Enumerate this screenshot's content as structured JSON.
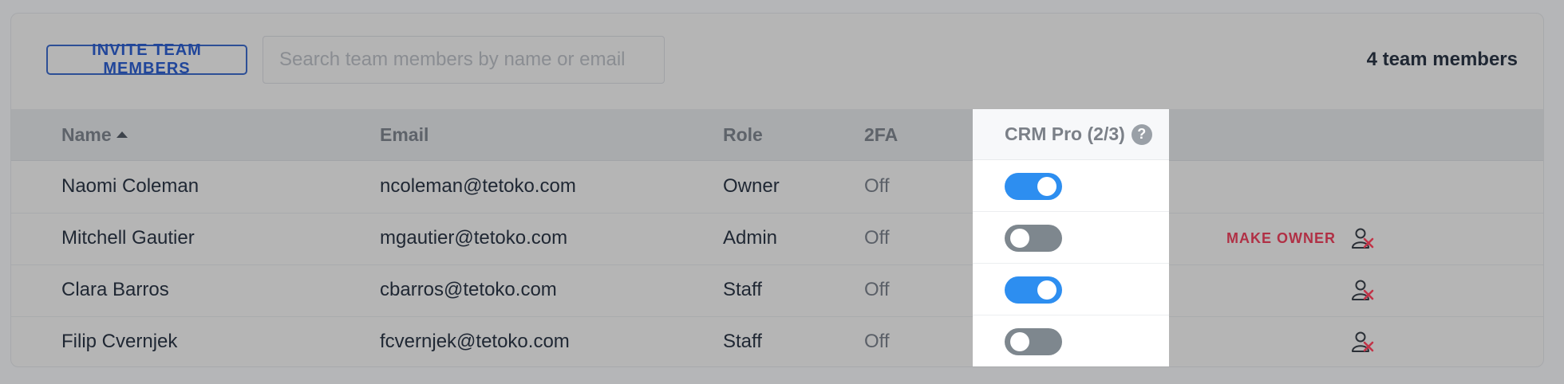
{
  "toolbar": {
    "invite_label": "INVITE TEAM MEMBERS",
    "search_placeholder": "Search team members by name or email",
    "member_count": "4 team members"
  },
  "table": {
    "columns": {
      "name": "Name",
      "email": "Email",
      "role": "Role",
      "twofa": "2FA",
      "crm": "CRM Pro (2/3)"
    },
    "sort": {
      "column": "name",
      "direction": "ascending",
      "icon": "sort-up-icon"
    },
    "rows": [
      {
        "name": "Naomi Coleman",
        "email": "ncoleman@tetoko.com",
        "role": "Owner",
        "twofa": "Off",
        "crm_enabled": true,
        "make_owner": "",
        "removable": false
      },
      {
        "name": "Mitchell Gautier",
        "email": "mgautier@tetoko.com",
        "role": "Admin",
        "twofa": "Off",
        "crm_enabled": false,
        "make_owner": "MAKE OWNER",
        "removable": true
      },
      {
        "name": "Clara Barros",
        "email": "cbarros@tetoko.com",
        "role": "Staff",
        "twofa": "Off",
        "crm_enabled": true,
        "make_owner": "",
        "removable": true
      },
      {
        "name": "Filip Cvernjek",
        "email": "fcvernjek@tetoko.com",
        "role": "Staff",
        "twofa": "Off",
        "crm_enabled": false,
        "make_owner": "",
        "removable": true
      }
    ]
  },
  "icons": {
    "help": "question-circle-icon",
    "remove": "remove-user-icon"
  },
  "colors": {
    "accent": "#2d8ef0",
    "danger": "#b03045",
    "toggle_off": "#7e878e",
    "invite_border": "#2d4f96"
  }
}
